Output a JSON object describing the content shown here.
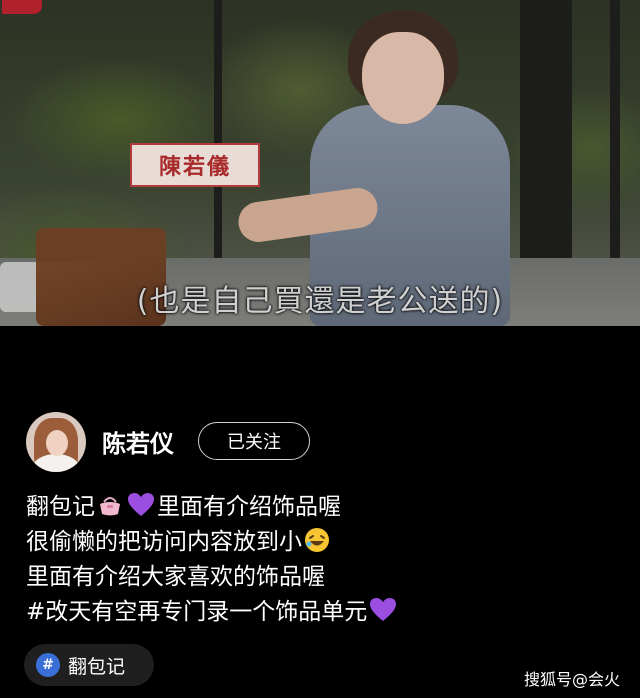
{
  "video": {
    "name_sign": "陳若儀",
    "subtitle": "(也是自己買還是老公送的)"
  },
  "post": {
    "username": "陈若仪",
    "follow_label": "已关注",
    "caption_lines": [
      {
        "before": "翻包记",
        "emojis": [
          "purse-icon",
          "purple-heart-icon"
        ],
        "after": "里面有介绍饰品喔"
      },
      {
        "before": "很偷懒的把访问内容放到小",
        "emojis": [
          "laughing-face-icon"
        ],
        "after": ""
      },
      {
        "before": "里面有介绍大家喜欢的饰品喔",
        "emojis": [],
        "after": ""
      },
      {
        "before": "#改天有空再专门录一个饰品单元",
        "emojis": [
          "purple-heart-icon"
        ],
        "after": ""
      }
    ],
    "tag": {
      "icon": "hashtag-icon",
      "label": "翻包记"
    }
  },
  "footer": {
    "source": "搜狐号@会火"
  },
  "colors": {
    "background": "#000000",
    "tag_icon": "#3b6fd8",
    "heart": "#9b4ee0"
  }
}
